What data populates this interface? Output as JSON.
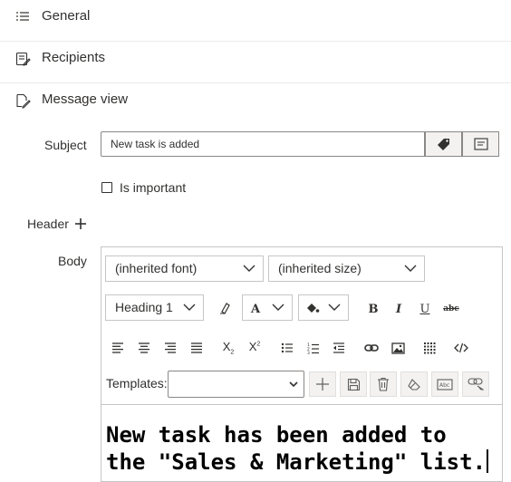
{
  "sections": {
    "general": "General",
    "recipients": "Recipients",
    "message_view": "Message view"
  },
  "subject": {
    "label": "Subject",
    "value": "New task is added",
    "icons": [
      "tag-icon",
      "field-picker-icon"
    ]
  },
  "important": {
    "label": "Is important",
    "checked": false
  },
  "header": {
    "label": "Header",
    "add_icon": "plus-icon"
  },
  "body": {
    "label": "Body",
    "font_select": "(inherited font)",
    "size_select": "(inherited size)",
    "format_select": "Heading 1",
    "templates_label": "Templates:",
    "templates_value": "",
    "content_line1": "New task has been added to",
    "content_line2": "the \"Sales & Marketing\" list."
  },
  "toolbar": {
    "row1": [
      "clear-format-icon",
      "font-color-icon",
      "highlight-color-icon",
      "bold-icon",
      "italic-icon",
      "underline-icon",
      "strikethrough-icon"
    ],
    "row2": [
      "align-left-icon",
      "align-center-icon",
      "align-right-icon",
      "justify-icon",
      "subscript-icon",
      "superscript-icon",
      "bullet-list-icon",
      "numbered-list-icon",
      "outdent-icon",
      "link-icon",
      "image-icon",
      "table-icon",
      "html-source-icon"
    ],
    "row3": [
      "add-icon",
      "save-icon",
      "delete-icon",
      "eraser-icon",
      "text-field-icon",
      "link-field-icon"
    ]
  },
  "colors": {
    "border": "#c8c6c4",
    "input_border": "#8a8886",
    "text": "#323130",
    "button_bg": "#f3f2f1"
  }
}
